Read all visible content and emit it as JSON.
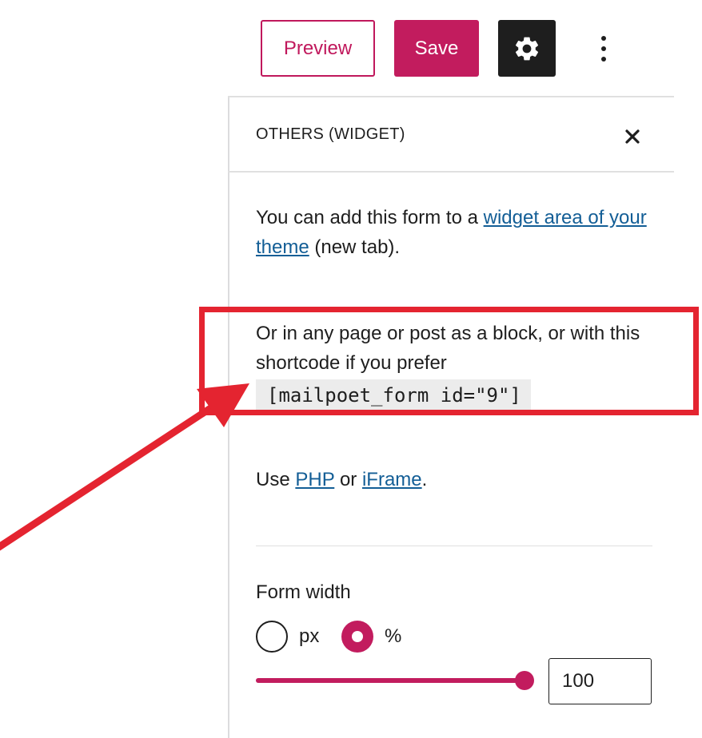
{
  "toolbar": {
    "preview_label": "Preview",
    "save_label": "Save",
    "settings_icon": "gear-icon",
    "more_icon": "more-vertical-icon"
  },
  "panel": {
    "title": "OTHERS (WIDGET)",
    "close_icon": "close-icon",
    "widget_text_before": "You can add this form to a ",
    "widget_link": "widget area of your theme",
    "widget_text_after": " (new tab).",
    "shortcode_text": "Or in any page or post as a block, or with this shortcode if you prefer",
    "shortcode": "[mailpoet_form id=\"9\"]",
    "use_text": "Use ",
    "php_link": "PHP",
    "or_text": " or ",
    "iframe_link": "iFrame",
    "period": "."
  },
  "form_width": {
    "label": "Form width",
    "units": [
      {
        "label": "px",
        "checked": false
      },
      {
        "label": "%",
        "checked": true
      }
    ],
    "slider_fraction": 1.0,
    "value": "100"
  },
  "colors": {
    "accent": "#c21c5e",
    "link": "#135e96",
    "annotation": "#e42430"
  }
}
